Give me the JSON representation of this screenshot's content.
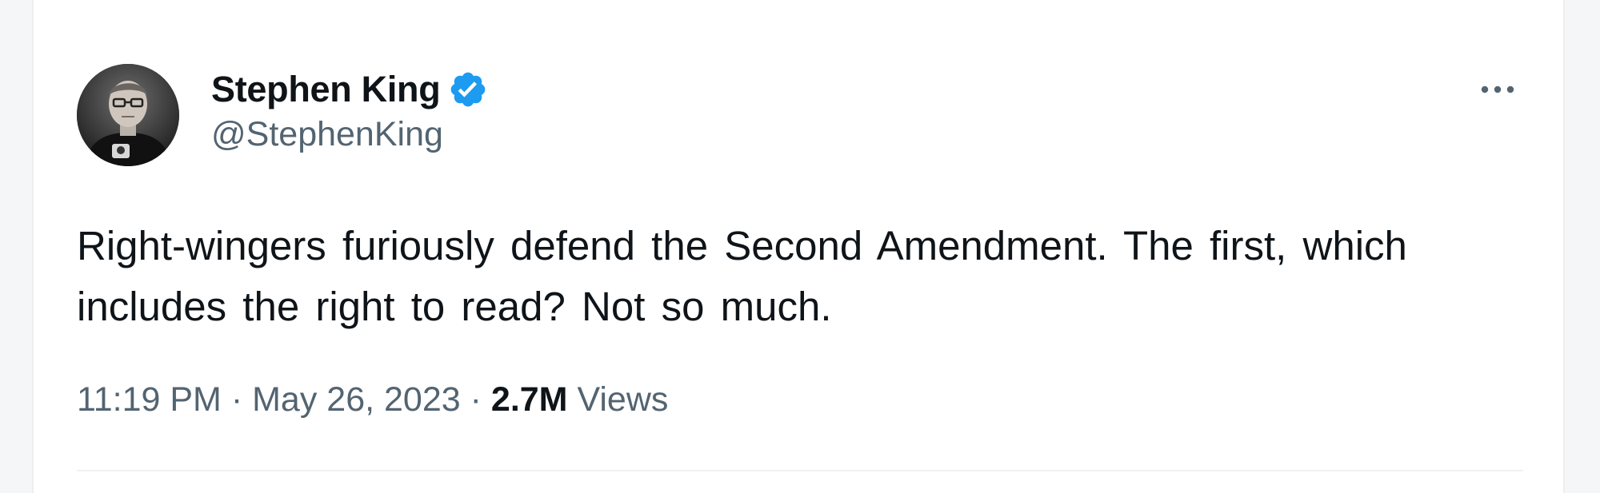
{
  "tweet": {
    "author": {
      "display_name": "Stephen King",
      "handle": "@StephenKing",
      "verified": true,
      "avatar_icon": "author-avatar"
    },
    "text": "Right-wingers furiously defend the Second Amendment. The first, which includes the right to read? Not so much.",
    "time": "11:19 PM",
    "date": "May 26, 2023",
    "views_count": "2.7M",
    "views_label": "Views",
    "separator": "·",
    "more_icon": "more-options-icon"
  },
  "colors": {
    "text_primary": "#0f1419",
    "text_secondary": "#536471",
    "verified_blue": "#1d9bf0",
    "background": "#ffffff"
  }
}
